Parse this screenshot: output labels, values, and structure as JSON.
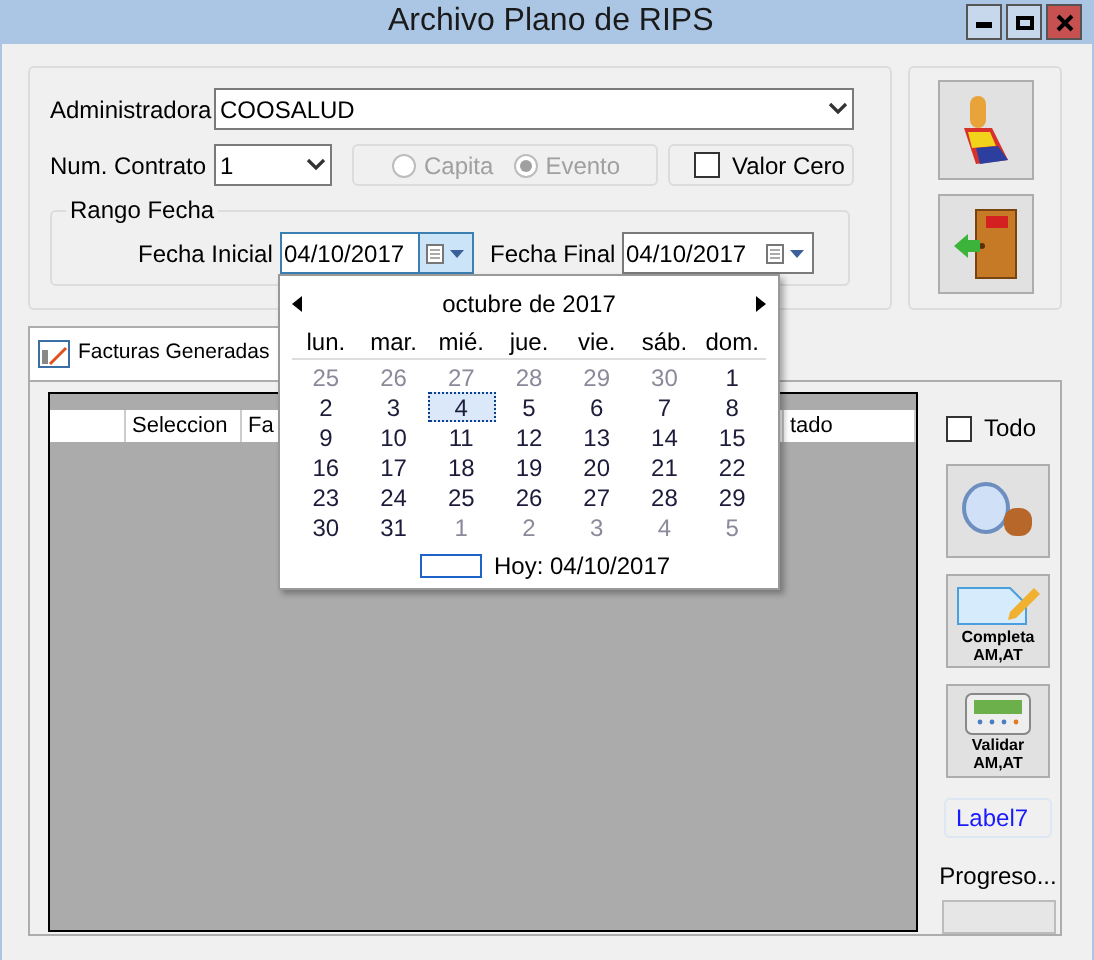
{
  "window": {
    "title": "Archivo Plano de RIPS"
  },
  "form": {
    "administradora_label": "Administradora",
    "administradora_value": "COOSALUD",
    "contrato_label": "Num. Contrato",
    "contrato_value": "1",
    "radios": [
      {
        "label": "Capita",
        "selected": false,
        "disabled": true
      },
      {
        "label": "Evento",
        "selected": true,
        "disabled": true
      }
    ],
    "valor_cero": {
      "label": "Valor Cero",
      "checked": false
    },
    "rango": {
      "title": "Rango Fecha",
      "inicial_label": "Fecha Inicial",
      "inicial_value": "04/10/2017",
      "inicial_focused": true,
      "final_label": "Fecha Final",
      "final_value": "04/10/2017",
      "final_focused": false
    }
  },
  "calendar": {
    "month": "octubre de 2017",
    "weekdays": [
      "lun.",
      "mar.",
      "mié.",
      "jue.",
      "vie.",
      "sáb.",
      "dom."
    ],
    "days": [
      {
        "label": "25",
        "in_month": false,
        "selected": false
      },
      {
        "label": "26",
        "in_month": false,
        "selected": false
      },
      {
        "label": "27",
        "in_month": false,
        "selected": false
      },
      {
        "label": "28",
        "in_month": false,
        "selected": false
      },
      {
        "label": "29",
        "in_month": false,
        "selected": false
      },
      {
        "label": "30",
        "in_month": false,
        "selected": false
      },
      {
        "label": "1",
        "in_month": true,
        "selected": false
      },
      {
        "label": "2",
        "in_month": true,
        "selected": false
      },
      {
        "label": "3",
        "in_month": true,
        "selected": false
      },
      {
        "label": "4",
        "in_month": true,
        "selected": true
      },
      {
        "label": "5",
        "in_month": true,
        "selected": false
      },
      {
        "label": "6",
        "in_month": true,
        "selected": false
      },
      {
        "label": "7",
        "in_month": true,
        "selected": false
      },
      {
        "label": "8",
        "in_month": true,
        "selected": false
      },
      {
        "label": "9",
        "in_month": true,
        "selected": false
      },
      {
        "label": "10",
        "in_month": true,
        "selected": false
      },
      {
        "label": "11",
        "in_month": true,
        "selected": false
      },
      {
        "label": "12",
        "in_month": true,
        "selected": false
      },
      {
        "label": "13",
        "in_month": true,
        "selected": false
      },
      {
        "label": "14",
        "in_month": true,
        "selected": false
      },
      {
        "label": "15",
        "in_month": true,
        "selected": false
      },
      {
        "label": "16",
        "in_month": true,
        "selected": false
      },
      {
        "label": "17",
        "in_month": true,
        "selected": false
      },
      {
        "label": "18",
        "in_month": true,
        "selected": false
      },
      {
        "label": "19",
        "in_month": true,
        "selected": false
      },
      {
        "label": "20",
        "in_month": true,
        "selected": false
      },
      {
        "label": "21",
        "in_month": true,
        "selected": false
      },
      {
        "label": "22",
        "in_month": true,
        "selected": false
      },
      {
        "label": "23",
        "in_month": true,
        "selected": false
      },
      {
        "label": "24",
        "in_month": true,
        "selected": false
      },
      {
        "label": "25",
        "in_month": true,
        "selected": false
      },
      {
        "label": "26",
        "in_month": true,
        "selected": false
      },
      {
        "label": "27",
        "in_month": true,
        "selected": false
      },
      {
        "label": "28",
        "in_month": true,
        "selected": false
      },
      {
        "label": "29",
        "in_month": true,
        "selected": false
      },
      {
        "label": "30",
        "in_month": true,
        "selected": false
      },
      {
        "label": "31",
        "in_month": true,
        "selected": false
      },
      {
        "label": "1",
        "in_month": false,
        "selected": false
      },
      {
        "label": "2",
        "in_month": false,
        "selected": false
      },
      {
        "label": "3",
        "in_month": false,
        "selected": false
      },
      {
        "label": "4",
        "in_month": false,
        "selected": false
      },
      {
        "label": "5",
        "in_month": false,
        "selected": false
      }
    ],
    "today": "Hoy: 04/10/2017"
  },
  "tabs": [
    {
      "label": "Facturas Generadas",
      "selected": true
    }
  ],
  "table": {
    "columns": [
      "Seleccion",
      "Fa",
      "tado"
    ]
  },
  "side": {
    "todo": {
      "label": "Todo",
      "checked": false
    },
    "buttons": [
      {
        "kind": "search"
      },
      {
        "kind": "complete",
        "label": "Completa AM,AT"
      },
      {
        "kind": "validate",
        "label": "Validar AM,AT"
      }
    ],
    "label7": "Label7",
    "progress_label": "Progreso...",
    "progress": {
      "level": 0
    }
  }
}
